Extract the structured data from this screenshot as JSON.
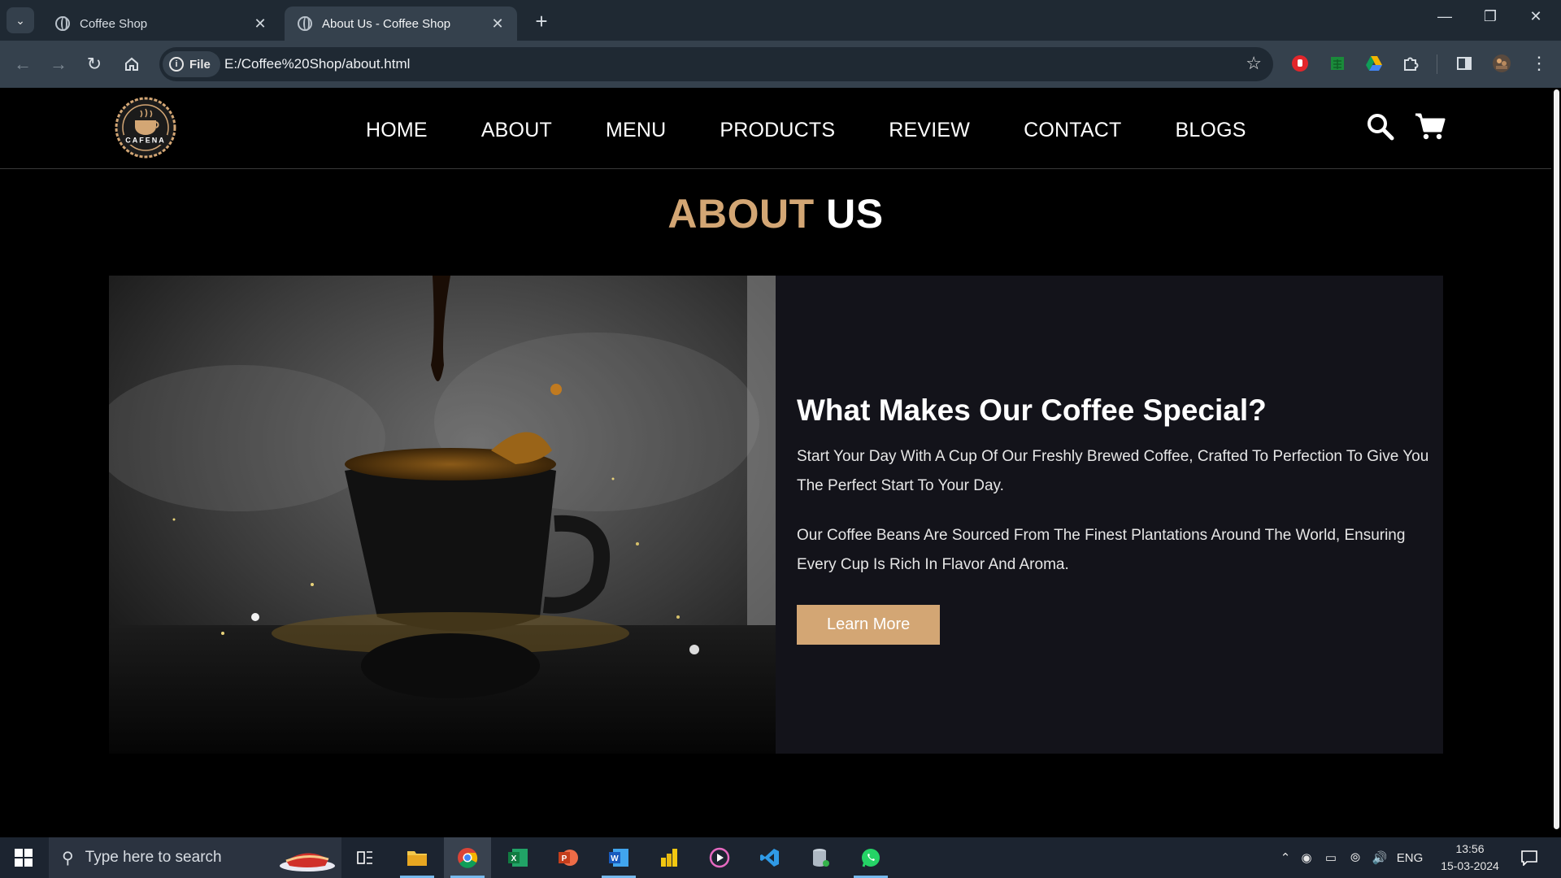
{
  "browser": {
    "tabs": [
      {
        "title": "Coffee Shop",
        "active": false
      },
      {
        "title": "About Us - Coffee Shop",
        "active": true
      }
    ],
    "address": {
      "chip_label": "File",
      "url": "E:/Coffee%20Shop/about.html"
    }
  },
  "site": {
    "logo_text": "CAFENA",
    "nav": [
      "HOME",
      "ABOUT",
      "MENU",
      "PRODUCTS",
      "REVIEW",
      "CONTACT",
      "BLOGS"
    ],
    "heading_accent": "ABOUT",
    "heading_rest": "US",
    "about": {
      "title": "What Makes Our Coffee Special?",
      "para1": "Start Your Day With A Cup Of Our Freshly Brewed Coffee, Crafted To Perfection To Give You The Perfect Start To Your Day.",
      "para2": "Our Coffee Beans Are Sourced From The Finest Plantations Around The World, Ensuring Every Cup Is Rich In Flavor And Aroma.",
      "button": "Learn More"
    },
    "colors": {
      "accent": "#d3a674",
      "panel": "#13131a",
      "background": "#000000"
    }
  },
  "taskbar": {
    "search_placeholder": "Type here to search",
    "language": "ENG",
    "time": "13:56",
    "date": "15-03-2024"
  }
}
